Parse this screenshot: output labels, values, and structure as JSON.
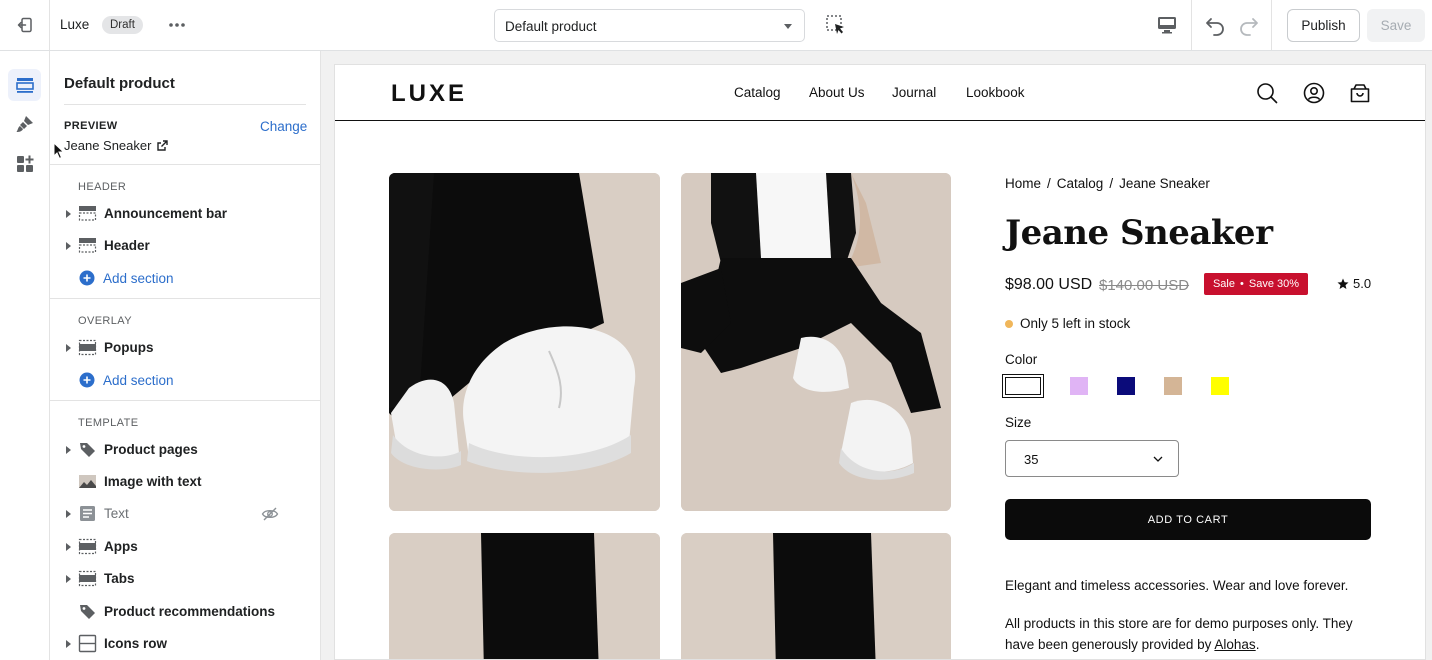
{
  "topbar": {
    "store_name": "Luxe",
    "status_badge": "Draft",
    "template_select": "Default product",
    "publish_label": "Publish",
    "save_label": "Save"
  },
  "sidebar": {
    "title": "Default product",
    "preview_label": "PREVIEW",
    "change_label": "Change",
    "preview_value": "Jeane Sneaker",
    "groups": [
      {
        "label": "HEADER",
        "items": [
          {
            "label": "Announcement bar",
            "icon": "section-icon"
          },
          {
            "label": "Header",
            "icon": "section-icon"
          }
        ],
        "add_label": "Add section"
      },
      {
        "label": "OVERLAY",
        "items": [
          {
            "label": "Popups",
            "icon": "section-icon"
          }
        ],
        "add_label": "Add section"
      },
      {
        "label": "TEMPLATE",
        "items": [
          {
            "label": "Product pages",
            "icon": "tag-icon"
          },
          {
            "label": "Image with text",
            "icon": "image-thumb-icon"
          },
          {
            "label": "Text",
            "icon": "text-block-icon",
            "hidden": true
          },
          {
            "label": "Apps",
            "icon": "section-icon"
          },
          {
            "label": "Tabs",
            "icon": "section-icon"
          },
          {
            "label": "Product recommendations",
            "icon": "tag-icon"
          },
          {
            "label": "Icons row",
            "icon": "grid-icon"
          }
        ]
      }
    ]
  },
  "store": {
    "logo": "LUXE",
    "nav": [
      "Catalog",
      "About Us",
      "Journal",
      "Lookbook"
    ],
    "breadcrumb": [
      "Home",
      "/",
      "Catalog",
      "/",
      "Jeane Sneaker"
    ],
    "product_title": "Jeane Sneaker",
    "price": "$98.00 USD",
    "compare_price": "$140.00 USD",
    "sale_badge": {
      "sale": "Sale",
      "dot": "•",
      "save": "Save 30%"
    },
    "rating": "5.0",
    "stock_text": "Only 5 left in stock",
    "color_label": "Color",
    "colors": [
      "#ffffff",
      "#e0b4f5",
      "#0b0b7a",
      "#d4b596",
      "#ffff00"
    ],
    "size_label": "Size",
    "size_value": "35",
    "add_to_cart": "ADD TO CART",
    "description_1": "Elegant and timeless accessories. Wear and love forever.",
    "description_2_prefix": "All products in this store are for demo purposes only. They have been generously provided by ",
    "description_2_link": "Alohas",
    "description_2_suffix": "."
  },
  "colors": {
    "accent_blue": "#2c6ecb",
    "sale_red": "#c8102e",
    "stock_dot": "#f0b65a"
  }
}
